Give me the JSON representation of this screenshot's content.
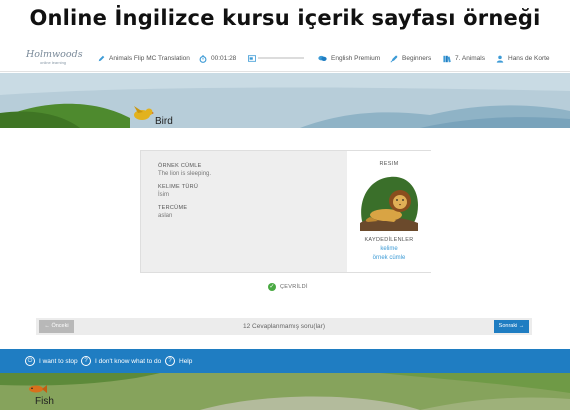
{
  "page_title": "Online İngilizce kursu içerik sayfası örneği",
  "topbar": {
    "logo_main": "Holmwoods",
    "logo_sub": "online learning",
    "lesson": "Animals Flip MC Translation",
    "timer": "00:01:28",
    "progress": 0,
    "course": "English Premium",
    "level": "Beginners",
    "unit": "7. Animals",
    "user": "Hans de Korte"
  },
  "banner": {
    "top_label": "Bird",
    "bottom_label": "Fish"
  },
  "card": {
    "example_label": "ÖRNEK CÜMLE",
    "example_value": "The lion is sleeping.",
    "wordtype_label": "KELIME TÜRÜ",
    "wordtype_value": "İsim",
    "translation_label": "TERCÜME",
    "translation_value": "aslan",
    "image_label": "RESIM",
    "saved_label": "KAYDEDİLENLER",
    "saved_word": "kelime",
    "saved_sentence": "örnek cümle"
  },
  "status": {
    "translated": "ÇEVRİLDİ"
  },
  "navigation": {
    "prev_label": "← Önceki",
    "status_text": "12 Cevaplanmamış soru(lar)",
    "next_label": "Sonraki →"
  },
  "help": {
    "stop_label": "I want to stop",
    "dont_know_label": "I don't know what to do",
    "help_label": "Help"
  },
  "colors": {
    "primary_blue": "#1f7dc2",
    "link_blue": "#3d9bd6",
    "success_green": "#49a942"
  }
}
